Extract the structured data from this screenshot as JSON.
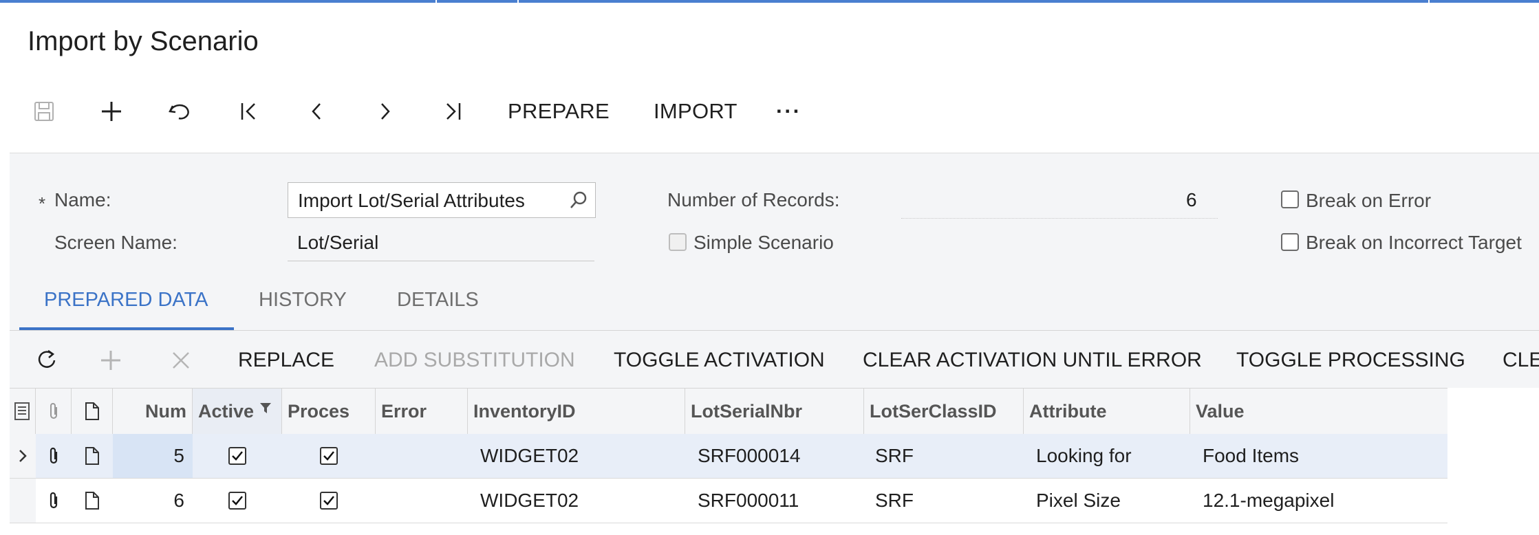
{
  "page": {
    "title": "Import by Scenario"
  },
  "toolbar": {
    "save_icon": "save-icon",
    "add_icon": "plus-icon",
    "undo_icon": "undo-icon",
    "first_icon": "first-record-icon",
    "prev_icon": "chevron-left-icon",
    "next_icon": "chevron-right-icon",
    "last_icon": "last-record-icon",
    "prepare_label": "PREPARE",
    "import_label": "IMPORT",
    "more_label": "···"
  },
  "form": {
    "name_required_mark": "*",
    "name_label": "Name:",
    "name_value": "Import Lot/Serial Attributes",
    "screen_name_label": "Screen Name:",
    "screen_name_value": "Lot/Serial",
    "records_label": "Number of Records:",
    "records_value": "6",
    "simple_scenario_label": "Simple Scenario",
    "break_on_error_label": "Break on Error",
    "break_on_incorrect_target_label": "Break on Incorrect Target"
  },
  "tabs": [
    {
      "label": "PREPARED DATA",
      "active": true
    },
    {
      "label": "HISTORY",
      "active": false
    },
    {
      "label": "DETAILS",
      "active": false
    }
  ],
  "grid_toolbar": {
    "refresh_icon": "refresh-icon",
    "add_icon": "plus-icon",
    "delete_icon": "close-icon",
    "replace_label": "REPLACE",
    "add_substitution_label": "ADD SUBSTITUTION",
    "toggle_activation_label": "TOGGLE ACTIVATION",
    "clear_activation_label": "CLEAR ACTIVATION UNTIL ERROR",
    "toggle_processing_label": "TOGGLE PROCESSING",
    "truncated_label": "CLE"
  },
  "grid": {
    "columns": [
      "Num",
      "Active",
      "Proces",
      "Error",
      "InventoryID",
      "LotSerialNbr",
      "LotSerClassID",
      "Attribute",
      "Value"
    ],
    "rows": [
      {
        "num": "5",
        "active": true,
        "processed": true,
        "error": "",
        "inventory_id": "WIDGET02",
        "lot_serial_nbr": "SRF000014",
        "lot_ser_class_id": "SRF",
        "attribute": "Looking for",
        "value": "Food Items",
        "selected": true
      },
      {
        "num": "6",
        "active": true,
        "processed": true,
        "error": "",
        "inventory_id": "WIDGET02",
        "lot_serial_nbr": "SRF000011",
        "lot_ser_class_id": "SRF",
        "attribute": "Pixel Size",
        "value": "12.1-megapixel",
        "selected": false
      }
    ]
  },
  "colors": {
    "accent": "#3b73c7",
    "top_bar": "#4a7fd0",
    "panel": "#f4f5f7",
    "selected_row": "#e8eef8"
  }
}
